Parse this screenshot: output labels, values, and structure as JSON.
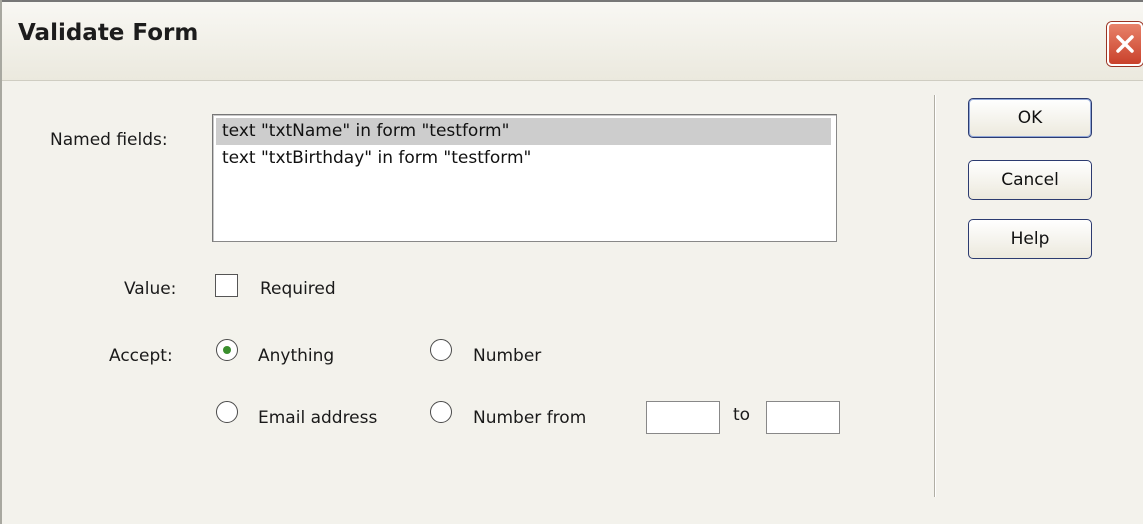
{
  "window": {
    "title": "Validate Form"
  },
  "named_fields": {
    "label": "Named fields:",
    "items": [
      "text \"txtName\" in form \"testform\"",
      "text \"txtBirthday\" in form \"testform\""
    ],
    "selected_index": 0
  },
  "value": {
    "label": "Value:",
    "required_label": "Required",
    "required_checked": false
  },
  "accept": {
    "label": "Accept:",
    "options": {
      "anything": "Anything",
      "number": "Number",
      "email": "Email address",
      "number_from": "Number from"
    },
    "selected": "anything",
    "to_label": "to",
    "from_value": "",
    "to_value": ""
  },
  "buttons": {
    "ok": "OK",
    "cancel": "Cancel",
    "help": "Help"
  },
  "colors": {
    "selection": "#cdcdcd",
    "radio_dot": "#3a8f2e",
    "close_button": "#c9412b"
  }
}
